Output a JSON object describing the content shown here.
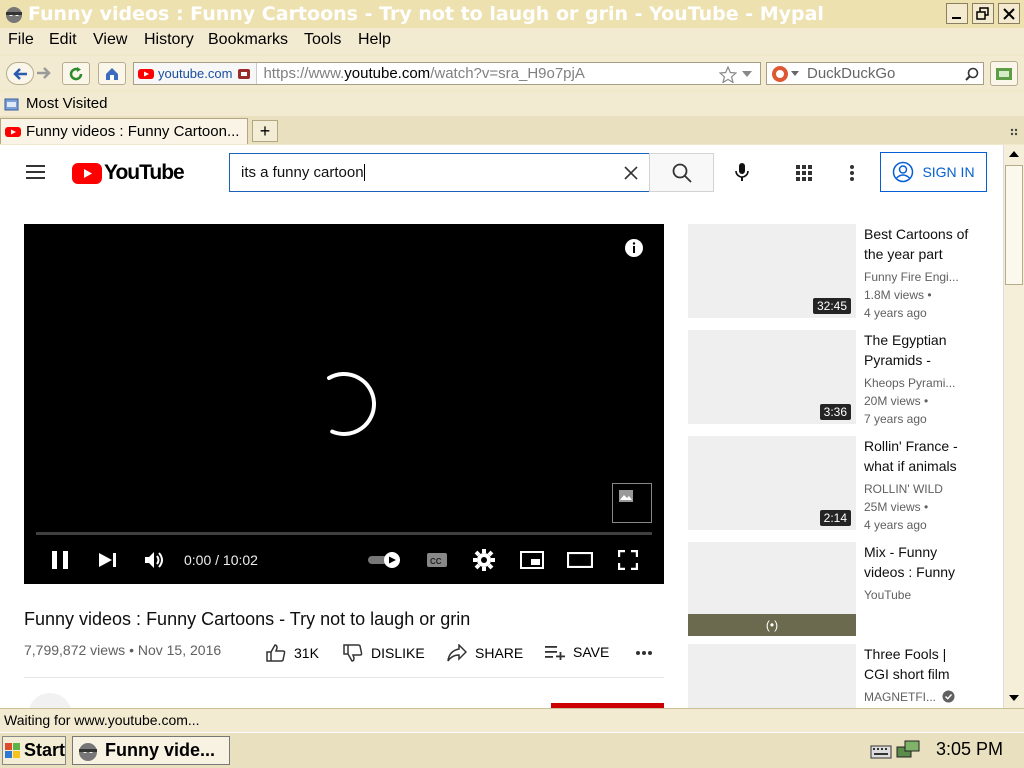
{
  "window": {
    "title": "Funny videos : Funny Cartoons - Try not to laugh or grin - YouTube - Mypal"
  },
  "menu": [
    "File",
    "Edit",
    "View",
    "History",
    "Bookmarks",
    "Tools",
    "Help"
  ],
  "nav": {
    "site_identity": "youtube.com",
    "url_prefix": "https://www.",
    "url_domain": "youtube.com",
    "url_path": "/watch?v=sra_H9o7pjA",
    "search_engine_placeholder": "DuckDuckGo"
  },
  "bookmarks": {
    "most_visited": "Most Visited"
  },
  "tab": {
    "label": "Funny videos : Funny Cartoon...",
    "new_tab": "+"
  },
  "youtube": {
    "logo_text": "YouTube",
    "search_value": "its a funny cartoon",
    "sign_in": "SIGN IN",
    "player": {
      "time": "0:00 / 10:02",
      "progress": 0.0
    },
    "video_title": "Funny videos : Funny Cartoons - Try not to laugh or grin",
    "video_meta": "7,799,872 views • Nov 15, 2016",
    "likes": "31K",
    "dislike": "DISLIKE",
    "share": "SHARE",
    "save": "SAVE",
    "related": [
      {
        "title": "Best Cartoons of the year part",
        "channel": "Funny Fire Engi...",
        "views": "1.8M views •",
        "age": "4 years ago",
        "duration": "32:45"
      },
      {
        "title": "The Egyptian Pyramids -",
        "channel": "Kheops Pyrami...",
        "views": "20M views •",
        "age": "7 years ago",
        "duration": "3:36"
      },
      {
        "title": "Rollin' France - what if animals",
        "channel": "ROLLIN' WILD",
        "views": "25M views •",
        "age": "4 years ago",
        "duration": "2:14"
      },
      {
        "title": "Mix - Funny videos : Funny",
        "channel": "YouTube",
        "views": "",
        "age": "",
        "duration": "(•)"
      },
      {
        "title": "Three Fools | CGI short film",
        "channel": "MAGNETFI...",
        "views": "",
        "age": "",
        "duration": ""
      }
    ]
  },
  "status": {
    "text": "Waiting for www.youtube.com..."
  },
  "taskbar": {
    "start": "Start",
    "task": "Funny vide...",
    "clock": "3:05 PM"
  },
  "colors": {
    "yt_red": "#ff0000",
    "titlebar_text": "#ffffff",
    "sign_in_blue": "#065fd4"
  }
}
